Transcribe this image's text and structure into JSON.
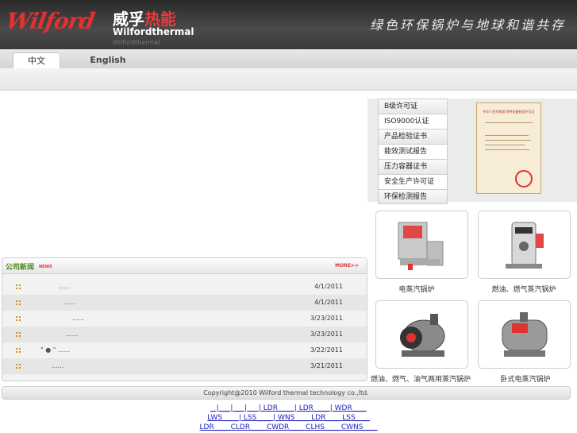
{
  "header": {
    "logo_text": "Wilford",
    "brand_cn_white": "威孚",
    "brand_cn_red": "热能",
    "brand_en": "Wilfordthermal",
    "brand_reflection": "Wilfordthermal",
    "slogan": "绿色环保锅炉与地球和谐共存"
  },
  "nav": {
    "tabs": [
      {
        "label": "中文"
      },
      {
        "label": "English"
      }
    ]
  },
  "certificates": {
    "items": [
      "B级许可证",
      "ISO9000认证",
      "产品检验证书",
      "能效测试报告",
      "压力容器证书",
      "安全生产许可证",
      "环保检测报告"
    ],
    "doc_title": "中华人民共和国 特种设备制造许可证"
  },
  "products": [
    {
      "label": "电蒸汽锅炉",
      "icon": "electric-boiler-icon"
    },
    {
      "label": "燃油、燃气蒸汽锅炉",
      "icon": "vertical-boiler-icon"
    },
    {
      "label": "燃油、燃气、油气两用蒸汽锅炉",
      "icon": "horizontal-boiler-icon"
    },
    {
      "label": "卧式电蒸汽锅炉",
      "icon": "horizontal-electric-boiler-icon"
    }
  ],
  "news": {
    "title": "公司新闻",
    "title_en": "NEWS",
    "more": "MORE>>",
    "rows": [
      {
        "text": "......",
        "date": "4/1/2011"
      },
      {
        "text": "......",
        "date": "4/1/2011"
      },
      {
        "text": "......",
        "date": "3/23/2011"
      },
      {
        "text": "......",
        "date": "3/23/2011"
      },
      {
        "text": "\" ● \"  ......",
        "date": "3/22/2011"
      },
      {
        "text": "......",
        "date": "3/21/2011"
      }
    ]
  },
  "footer": {
    "copyright": "Copyright@2010 Wilford thermal technology co.,ltd.",
    "link_rows": [
      "_ | __ | __ | __ | LDR____ | LDR____ | WDR____",
      "LWS____ | LSS____ | WNS____  LDR____  LSS____",
      "LDR____ CLDR____ CWDR____ CLHS____ CWNS____"
    ]
  }
}
